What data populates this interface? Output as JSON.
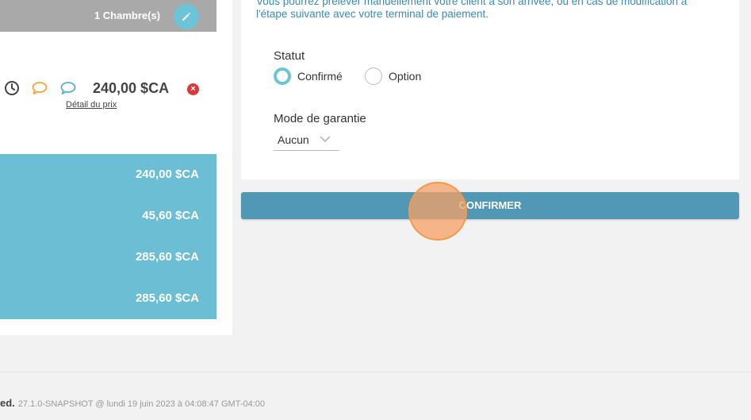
{
  "room_panel": {
    "room_count": "1 Chambre(s)",
    "room_price": "240,00 $CA",
    "remove_label": "×",
    "price_detail_link": "Détail du prix",
    "totals": [
      "240,00 $CA",
      "45,60 $CA",
      "285,60 $CA",
      "285,60 $CA"
    ]
  },
  "payment_card": {
    "info_text_line1": "Vous pourrez prélever manuellement votre client à son arrivée, ou en cas de modification à",
    "info_text_line2": "l'étape suivante avec votre terminal de paiement.",
    "status_label": "Statut",
    "status_options": [
      {
        "label": "Confirmé",
        "selected": true
      },
      {
        "label": "Option",
        "selected": false
      }
    ],
    "guarantee_label": "Mode de garantie",
    "guarantee_value": "Aucun"
  },
  "confirm_button_label": "CONFIRMER",
  "footer": {
    "rights_text": "ed.",
    "version_text": "27.1.0-SNAPSHOT @ lundi 19 juin 2023 à 04:08:47 GMT-04:00"
  },
  "colors": {
    "accent_teal": "#6cc4d8",
    "confirm_blue": "#5198b7",
    "totals_bg": "#6cbed4",
    "remove_red": "#d9383a",
    "chat_orange": "#f0a53a",
    "info_blue": "#3a8bb3"
  },
  "icons": [
    "pencil-icon",
    "clock-icon",
    "chat-bubble-icon",
    "close-icon",
    "chevron-down-icon"
  ]
}
